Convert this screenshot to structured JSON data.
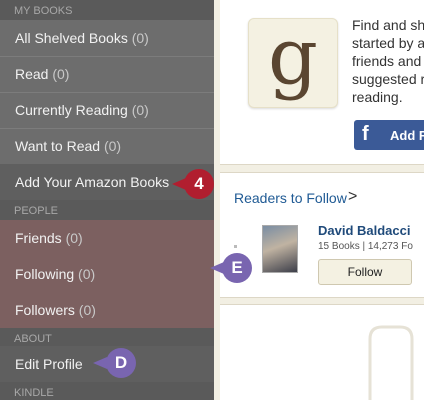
{
  "sidebar": {
    "sections": [
      {
        "header": "MY BOOKS"
      },
      {
        "header": "PEOPLE"
      },
      {
        "header": "ABOUT"
      },
      {
        "header": "KINDLE"
      }
    ],
    "items": [
      {
        "label": "All Shelved Books",
        "count": "(0)"
      },
      {
        "label": "Read",
        "count": "(0)"
      },
      {
        "label": "Currently Reading",
        "count": "(0)"
      },
      {
        "label": "Want to Read",
        "count": "(0)"
      },
      {
        "label": "Add Your Amazon Books",
        "count": ""
      },
      {
        "label": "Friends",
        "count": "(0)"
      },
      {
        "label": "Following",
        "count": "(0)"
      },
      {
        "label": "Followers",
        "count": "(0)"
      },
      {
        "label": "Edit Profile",
        "count": ""
      }
    ]
  },
  "main": {
    "logo_letter": "g",
    "find_text": "Find and sha\nstarted by a\nfriends and f\nsuggested re\nreading.",
    "facebook_button": {
      "icon": "f",
      "label": "Add Fri"
    },
    "readers": {
      "title": "Readers to Follow",
      "chevron": ">",
      "reader_name": "David Baldacci",
      "reader_stats": "15 Books | 14,273 Fo",
      "follow_label": "Follow"
    }
  },
  "callouts": {
    "four": "4",
    "e": "E",
    "d": "D"
  },
  "colors": {
    "sidebar_bg": "#6d6d6d",
    "facebook_blue": "#3b5a97",
    "link_blue": "#1f5a94",
    "callout_red": "#b11e2f",
    "callout_purple": "#7965b0"
  }
}
